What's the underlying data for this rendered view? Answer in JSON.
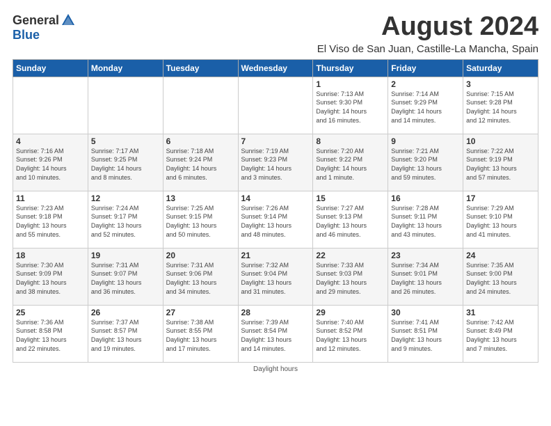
{
  "header": {
    "logo_general": "General",
    "logo_blue": "Blue",
    "title": "August 2024",
    "subtitle": "El Viso de San Juan, Castille-La Mancha, Spain"
  },
  "weekdays": [
    "Sunday",
    "Monday",
    "Tuesday",
    "Wednesday",
    "Thursday",
    "Friday",
    "Saturday"
  ],
  "weeks": [
    [
      {
        "day": "",
        "info": ""
      },
      {
        "day": "",
        "info": ""
      },
      {
        "day": "",
        "info": ""
      },
      {
        "day": "",
        "info": ""
      },
      {
        "day": "1",
        "info": "Sunrise: 7:13 AM\nSunset: 9:30 PM\nDaylight: 14 hours\nand 16 minutes."
      },
      {
        "day": "2",
        "info": "Sunrise: 7:14 AM\nSunset: 9:29 PM\nDaylight: 14 hours\nand 14 minutes."
      },
      {
        "day": "3",
        "info": "Sunrise: 7:15 AM\nSunset: 9:28 PM\nDaylight: 14 hours\nand 12 minutes."
      }
    ],
    [
      {
        "day": "4",
        "info": "Sunrise: 7:16 AM\nSunset: 9:26 PM\nDaylight: 14 hours\nand 10 minutes."
      },
      {
        "day": "5",
        "info": "Sunrise: 7:17 AM\nSunset: 9:25 PM\nDaylight: 14 hours\nand 8 minutes."
      },
      {
        "day": "6",
        "info": "Sunrise: 7:18 AM\nSunset: 9:24 PM\nDaylight: 14 hours\nand 6 minutes."
      },
      {
        "day": "7",
        "info": "Sunrise: 7:19 AM\nSunset: 9:23 PM\nDaylight: 14 hours\nand 3 minutes."
      },
      {
        "day": "8",
        "info": "Sunrise: 7:20 AM\nSunset: 9:22 PM\nDaylight: 14 hours\nand 1 minute."
      },
      {
        "day": "9",
        "info": "Sunrise: 7:21 AM\nSunset: 9:20 PM\nDaylight: 13 hours\nand 59 minutes."
      },
      {
        "day": "10",
        "info": "Sunrise: 7:22 AM\nSunset: 9:19 PM\nDaylight: 13 hours\nand 57 minutes."
      }
    ],
    [
      {
        "day": "11",
        "info": "Sunrise: 7:23 AM\nSunset: 9:18 PM\nDaylight: 13 hours\nand 55 minutes."
      },
      {
        "day": "12",
        "info": "Sunrise: 7:24 AM\nSunset: 9:17 PM\nDaylight: 13 hours\nand 52 minutes."
      },
      {
        "day": "13",
        "info": "Sunrise: 7:25 AM\nSunset: 9:15 PM\nDaylight: 13 hours\nand 50 minutes."
      },
      {
        "day": "14",
        "info": "Sunrise: 7:26 AM\nSunset: 9:14 PM\nDaylight: 13 hours\nand 48 minutes."
      },
      {
        "day": "15",
        "info": "Sunrise: 7:27 AM\nSunset: 9:13 PM\nDaylight: 13 hours\nand 46 minutes."
      },
      {
        "day": "16",
        "info": "Sunrise: 7:28 AM\nSunset: 9:11 PM\nDaylight: 13 hours\nand 43 minutes."
      },
      {
        "day": "17",
        "info": "Sunrise: 7:29 AM\nSunset: 9:10 PM\nDaylight: 13 hours\nand 41 minutes."
      }
    ],
    [
      {
        "day": "18",
        "info": "Sunrise: 7:30 AM\nSunset: 9:09 PM\nDaylight: 13 hours\nand 38 minutes."
      },
      {
        "day": "19",
        "info": "Sunrise: 7:31 AM\nSunset: 9:07 PM\nDaylight: 13 hours\nand 36 minutes."
      },
      {
        "day": "20",
        "info": "Sunrise: 7:31 AM\nSunset: 9:06 PM\nDaylight: 13 hours\nand 34 minutes."
      },
      {
        "day": "21",
        "info": "Sunrise: 7:32 AM\nSunset: 9:04 PM\nDaylight: 13 hours\nand 31 minutes."
      },
      {
        "day": "22",
        "info": "Sunrise: 7:33 AM\nSunset: 9:03 PM\nDaylight: 13 hours\nand 29 minutes."
      },
      {
        "day": "23",
        "info": "Sunrise: 7:34 AM\nSunset: 9:01 PM\nDaylight: 13 hours\nand 26 minutes."
      },
      {
        "day": "24",
        "info": "Sunrise: 7:35 AM\nSunset: 9:00 PM\nDaylight: 13 hours\nand 24 minutes."
      }
    ],
    [
      {
        "day": "25",
        "info": "Sunrise: 7:36 AM\nSunset: 8:58 PM\nDaylight: 13 hours\nand 22 minutes."
      },
      {
        "day": "26",
        "info": "Sunrise: 7:37 AM\nSunset: 8:57 PM\nDaylight: 13 hours\nand 19 minutes."
      },
      {
        "day": "27",
        "info": "Sunrise: 7:38 AM\nSunset: 8:55 PM\nDaylight: 13 hours\nand 17 minutes."
      },
      {
        "day": "28",
        "info": "Sunrise: 7:39 AM\nSunset: 8:54 PM\nDaylight: 13 hours\nand 14 minutes."
      },
      {
        "day": "29",
        "info": "Sunrise: 7:40 AM\nSunset: 8:52 PM\nDaylight: 13 hours\nand 12 minutes."
      },
      {
        "day": "30",
        "info": "Sunrise: 7:41 AM\nSunset: 8:51 PM\nDaylight: 13 hours\nand 9 minutes."
      },
      {
        "day": "31",
        "info": "Sunrise: 7:42 AM\nSunset: 8:49 PM\nDaylight: 13 hours\nand 7 minutes."
      }
    ]
  ],
  "footer": "Daylight hours"
}
